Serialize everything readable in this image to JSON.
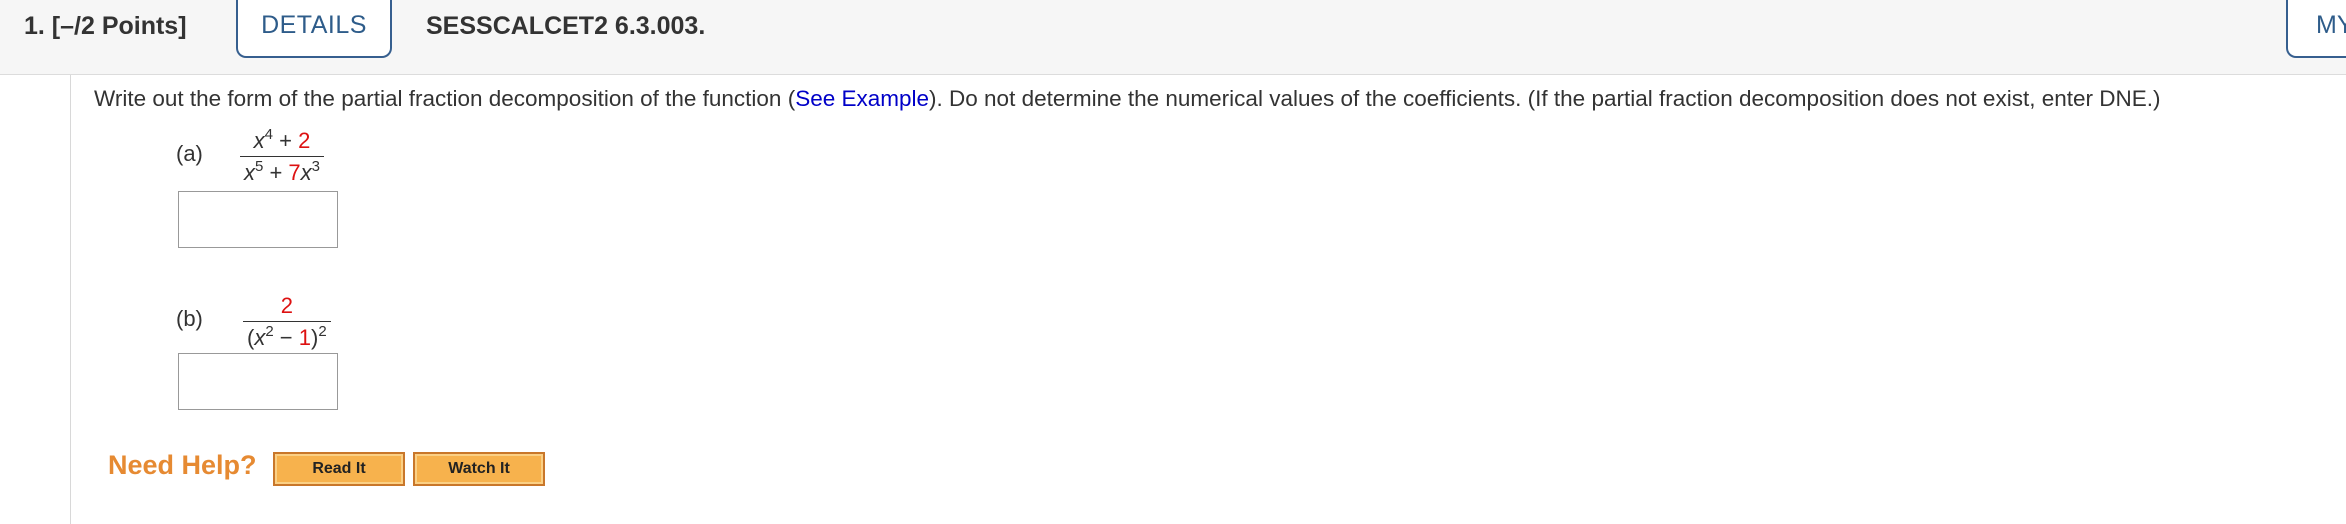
{
  "header": {
    "question_number": "1. [–/2 Points]",
    "details_label": "DETAILS",
    "question_id": "SESSCALCET2 6.3.003.",
    "my_label": "MY"
  },
  "instructions": {
    "text_before_link": "Write out the form of the partial fraction decomposition of the function (",
    "link_text": "See Example",
    "text_after_link": "). Do not determine the numerical values of the coefficients. (If the partial fraction decomposition does not exist, enter DNE.)"
  },
  "parts": [
    {
      "label": "(a)",
      "numerator": {
        "var": "x",
        "exp": "4",
        "op": " + ",
        "const": "2"
      },
      "denominator": {
        "var1": "x",
        "exp1": "5",
        "op": " + ",
        "coef": "7",
        "var2": "x",
        "exp2": "3"
      },
      "answer": ""
    },
    {
      "label": "(b)",
      "numerator": {
        "const": "2"
      },
      "denominator": {
        "open": "(",
        "var": "x",
        "exp": "2",
        "op": " − ",
        "const": "1",
        "close": ")",
        "outer_exp": "2"
      },
      "answer": ""
    }
  ],
  "help": {
    "label": "Need Help?",
    "read_it": "Read It",
    "watch_it": "Watch It"
  },
  "colors": {
    "accent": "#2e5c8a",
    "link": "#0000c8",
    "highlight_number": "#dd1111",
    "help_text": "#e68a32",
    "help_button": "#f7b24d"
  }
}
